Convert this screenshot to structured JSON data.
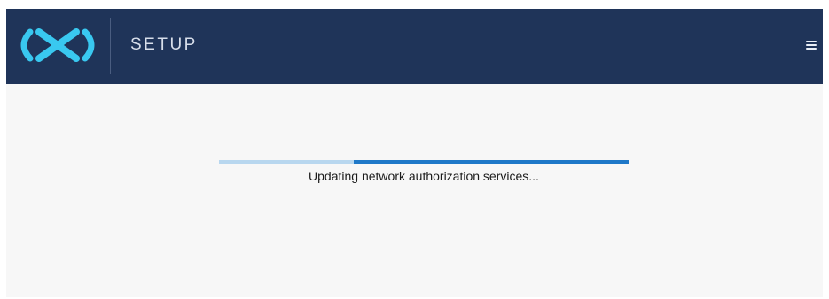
{
  "header": {
    "title": "SETUP",
    "logo_icon": "cx-logo",
    "menu_icon": "hamburger-menu-icon",
    "background_color": "#1f3459",
    "logo_color": "#39c8f0"
  },
  "main": {
    "status_message": "Updating network authorization services...",
    "progress": {
      "type": "indeterminate",
      "fill_start_fraction": 0.33,
      "fill_end_fraction": 1.0,
      "track_color": "#b8d7ef",
      "fill_color": "#1e78c8"
    }
  }
}
